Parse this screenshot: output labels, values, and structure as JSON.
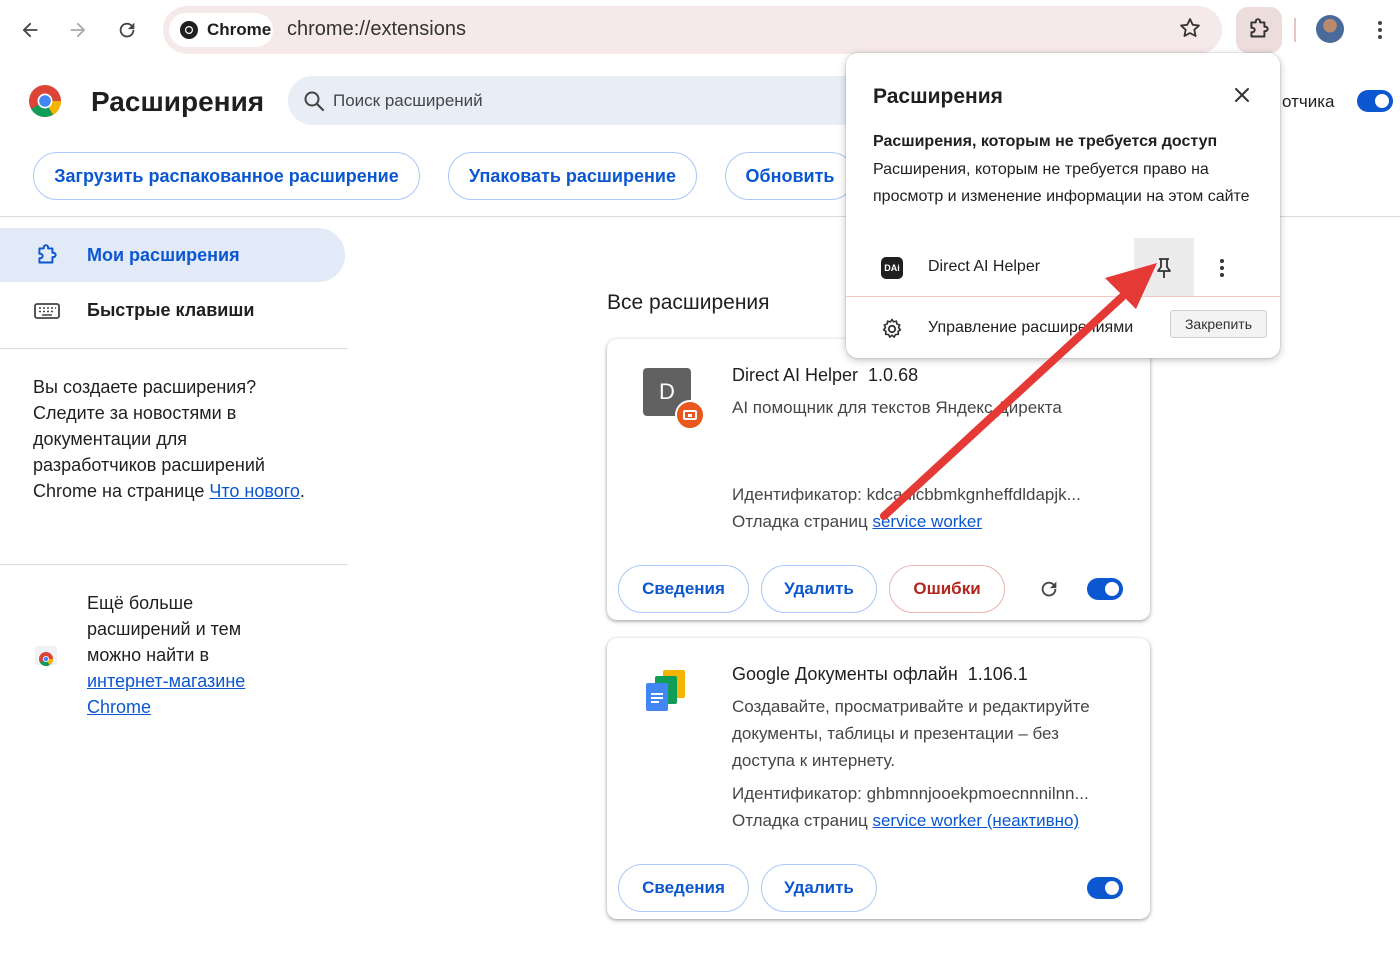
{
  "browser": {
    "chip_label": "Chrome",
    "url": "chrome://extensions"
  },
  "header": {
    "title": "Расширения",
    "search_placeholder": "Поиск расширений",
    "dev_mode_partial": "отчика"
  },
  "actions": {
    "load_unpacked": "Загрузить распакованное расширение",
    "pack": "Упаковать расширение",
    "update": "Обновить"
  },
  "sidebar": {
    "items": [
      {
        "label": "Мои расширения",
        "active": true
      },
      {
        "label": "Быстрые клавиши",
        "active": false
      }
    ],
    "dev_note": {
      "text": "Вы создаете расширения? Следите за новостями в документации для разработчиков расширений Chrome на странице ",
      "link": "Что нового",
      "tail": "."
    },
    "store_note": {
      "text": "Ещё больше расширений и тем можно найти в ",
      "link": "интернет-магазине Chrome"
    }
  },
  "main": {
    "section_title": "Все расширения",
    "extensions": [
      {
        "name": "Direct AI Helper",
        "version": "1.0.68",
        "description": "AI помощник для текстов Яндекс Директа",
        "id_label": "Идентификатор: kdcadicbbmkgnheffdldapjk...",
        "inspect_label": "Отладка страниц",
        "inspect_link": "service worker",
        "icon_letter": "D",
        "details": "Сведения",
        "remove": "Удалить",
        "errors": "Ошибки",
        "enabled": true
      },
      {
        "name": "Google Документы офлайн",
        "version": "1.106.1",
        "description": "Создавайте, просматривайте и редактируйте документы, таблицы и презентации – без доступа к интернету.",
        "id_label": "Идентификатор: ghbmnnjooekpmoecnnnilnn...",
        "inspect_label": "Отладка страниц",
        "inspect_link": "service worker (неактивно)",
        "details": "Сведения",
        "remove": "Удалить",
        "enabled": true
      }
    ]
  },
  "popup": {
    "title": "Расширения",
    "subtitle": "Расширения, которым не требуется доступ",
    "description": "Расширения, которым не требуется право на просмотр и изменение информации на этом сайте",
    "row_name": "Direct AI Helper",
    "row_icon_text": "DAi",
    "manage": "Управление расширениями",
    "tooltip": "Закрепить"
  },
  "colors": {
    "accent": "#0b57d0",
    "arrow": "#e53935",
    "error": "#b3261e"
  }
}
